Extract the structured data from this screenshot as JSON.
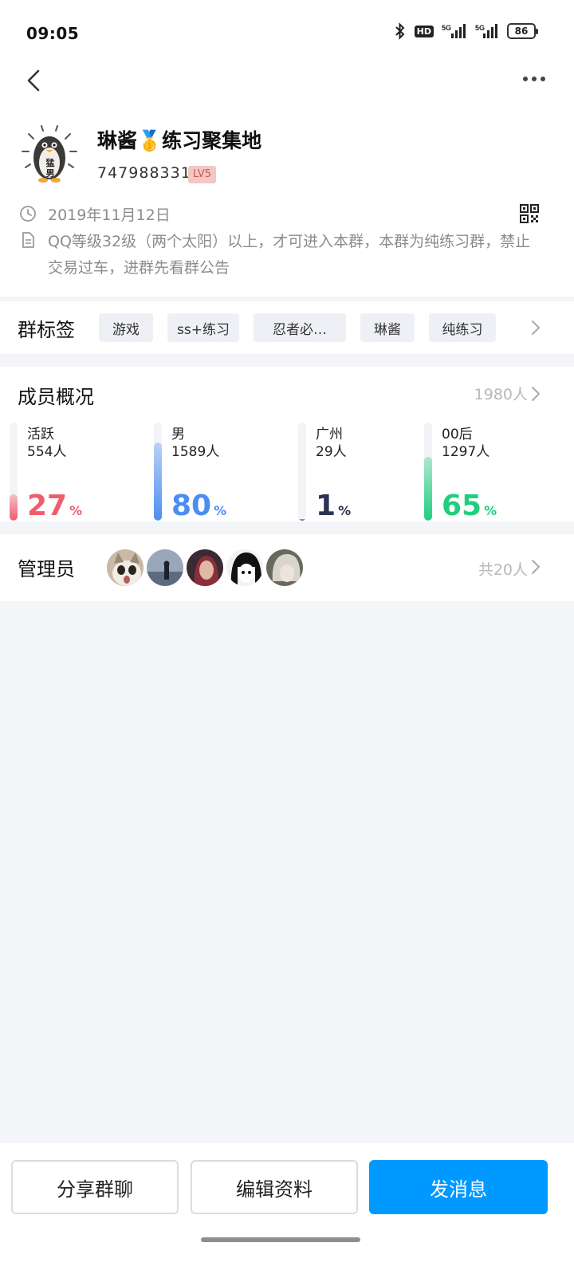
{
  "status_bar": {
    "time": "09:05",
    "hd": "HD",
    "network_1": "5G",
    "network_2": "5G",
    "battery": "86"
  },
  "nav": {
    "back_icon": "chevron-left-icon",
    "more_icon": "more-horizontal-icon"
  },
  "group": {
    "name": "琳酱🥇练习聚集地",
    "id": "747988331",
    "level": "LV5",
    "avatar_text": "猛男",
    "created_date": "2019年11月12日",
    "description": "QQ等级32级（两个太阳）以上，才可进入本群，本群为纯练习群，禁止交易过车，进群先看群公告"
  },
  "tags": {
    "title": "群标签",
    "items": [
      "游戏",
      "ss+练习",
      "忍者必…",
      "琳酱",
      "纯练习"
    ]
  },
  "members": {
    "title": "成员概况",
    "total": "1980人",
    "stats": [
      {
        "label": "活跃",
        "count": "554人",
        "value": "27",
        "unit": "%",
        "color": "#f05c6c"
      },
      {
        "label": "男",
        "count": "1589人",
        "value": "80",
        "unit": "%",
        "color": "#4c8ef0"
      },
      {
        "label": "广州",
        "count": "29人",
        "value": "1",
        "unit": "%",
        "color": "#2d3350"
      },
      {
        "label": "00后",
        "count": "1297人",
        "value": "65",
        "unit": "%",
        "color": "#1fcf7e"
      }
    ]
  },
  "admins": {
    "title": "管理员",
    "total": "共20人",
    "avatars": [
      "cat-avatar",
      "seaside-person-avatar",
      "red-hair-girl-avatar",
      "anime-girl-avatar",
      "white-hair-anime-avatar"
    ]
  },
  "actions": {
    "share": "分享群聊",
    "edit": "编辑资料",
    "send": "发消息"
  },
  "colors": {
    "primary": "#0099ff",
    "background": "#f4f5f9",
    "level_badge": "#f3c7c4"
  }
}
